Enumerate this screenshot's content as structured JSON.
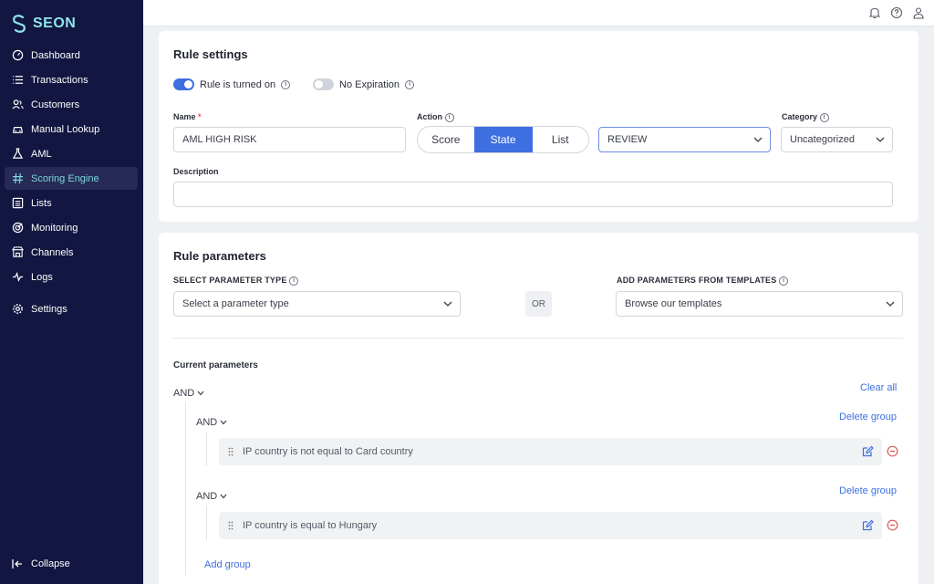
{
  "brand": {
    "name": "SEON"
  },
  "sidebar": {
    "items": [
      {
        "label": "Dashboard",
        "icon": "gauge-icon"
      },
      {
        "label": "Transactions",
        "icon": "list-icon"
      },
      {
        "label": "Customers",
        "icon": "users-icon"
      },
      {
        "label": "Manual Lookup",
        "icon": "car-icon"
      },
      {
        "label": "AML",
        "icon": "flask-icon"
      },
      {
        "label": "Scoring Engine",
        "icon": "hash-icon",
        "active": true
      },
      {
        "label": "Lists",
        "icon": "list-box-icon"
      },
      {
        "label": "Monitoring",
        "icon": "radar-icon"
      },
      {
        "label": "Channels",
        "icon": "channels-icon"
      },
      {
        "label": "Logs",
        "icon": "pulse-icon"
      },
      {
        "label": "Settings",
        "icon": "gear-icon"
      }
    ],
    "collapse_label": "Collapse"
  },
  "topbar": {
    "icons": [
      "bell-icon",
      "help-icon",
      "user-icon"
    ]
  },
  "rule_settings": {
    "title": "Rule settings",
    "toggle_rule_on": {
      "label": "Rule is turned on",
      "on": true
    },
    "toggle_no_expiration": {
      "label": "No Expiration",
      "on": false
    },
    "name_label": "Name",
    "name_required": "*",
    "name_value": "AML HIGH RISK",
    "action_label": "Action",
    "action_options": [
      "Score",
      "State",
      "List"
    ],
    "action_selected": "State",
    "state_value": "REVIEW",
    "category_label": "Category",
    "category_value": "Uncategorized",
    "description_label": "Description",
    "description_value": ""
  },
  "rule_parameters": {
    "title": "Rule parameters",
    "select_type_label": "SELECT PARAMETER TYPE",
    "select_type_placeholder": "Select a parameter type",
    "or_label": "OR",
    "templates_label": "ADD PARAMETERS FROM TEMPLATES",
    "templates_placeholder": "Browse our templates",
    "current_label": "Current parameters",
    "root_operator": "AND",
    "clear_all": "Clear all",
    "groups": [
      {
        "operator": "AND",
        "delete_label": "Delete group",
        "params": [
          "IP country is not equal to Card country"
        ]
      },
      {
        "operator": "AND",
        "delete_label": "Delete group",
        "params": [
          "IP country is equal to Hungary"
        ]
      }
    ],
    "add_group": "Add group"
  },
  "colors": {
    "sidebar_bg": "#121640",
    "accent": "#3d6fe0",
    "brand": "#8ee6ea",
    "danger": "#e0574f"
  }
}
